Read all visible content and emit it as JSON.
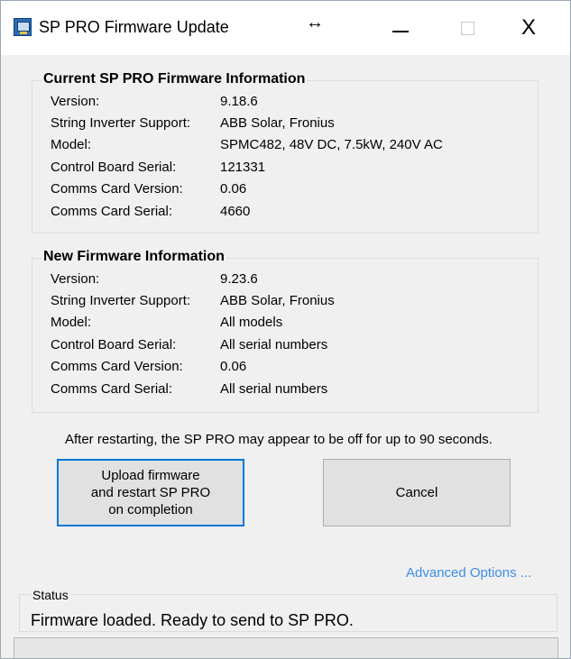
{
  "window": {
    "title": "SP PRO Firmware Update",
    "resize_glyph": "↔",
    "close_glyph": "X"
  },
  "current": {
    "heading": "Current SP PRO Firmware Information",
    "rows": [
      {
        "label": "Version:",
        "value": "9.18.6"
      },
      {
        "label": "String Inverter Support:",
        "value": "ABB Solar, Fronius"
      },
      {
        "label": "Model:",
        "value": "SPMC482, 48V DC, 7.5kW, 240V AC"
      },
      {
        "label": "Control Board Serial:",
        "value": "121331"
      },
      {
        "label": "Comms Card Version:",
        "value": "0.06"
      },
      {
        "label": "Comms Card Serial:",
        "value": "4660"
      }
    ]
  },
  "new_fw": {
    "heading": "New Firmware Information",
    "rows": [
      {
        "label": "Version:",
        "value": "9.23.6"
      },
      {
        "label": "String Inverter Support:",
        "value": "ABB Solar, Fronius"
      },
      {
        "label": "Model:",
        "value": "All models"
      },
      {
        "label": "Control Board Serial:",
        "value": "All serial numbers"
      },
      {
        "label": "Comms Card Version:",
        "value": "0.06"
      },
      {
        "label": "Comms Card Serial:",
        "value": "All serial numbers"
      }
    ]
  },
  "notice": "After restarting, the SP PRO may appear to be off for up to 90 seconds.",
  "buttons": {
    "upload_line1": "Upload firmware",
    "upload_line2": "and restart SP PRO",
    "upload_line3": "on completion",
    "cancel": "Cancel"
  },
  "advanced_link": "Advanced Options ...",
  "status": {
    "label": "Status",
    "text": "Firmware loaded. Ready to send to SP PRO."
  },
  "colors": {
    "accent": "#0078d7",
    "link": "#3b8ee6",
    "window_bg": "#f0f0f0"
  },
  "icons": [
    "app-icon",
    "resize-icon",
    "minimize-icon",
    "maximize-icon",
    "close-icon"
  ]
}
